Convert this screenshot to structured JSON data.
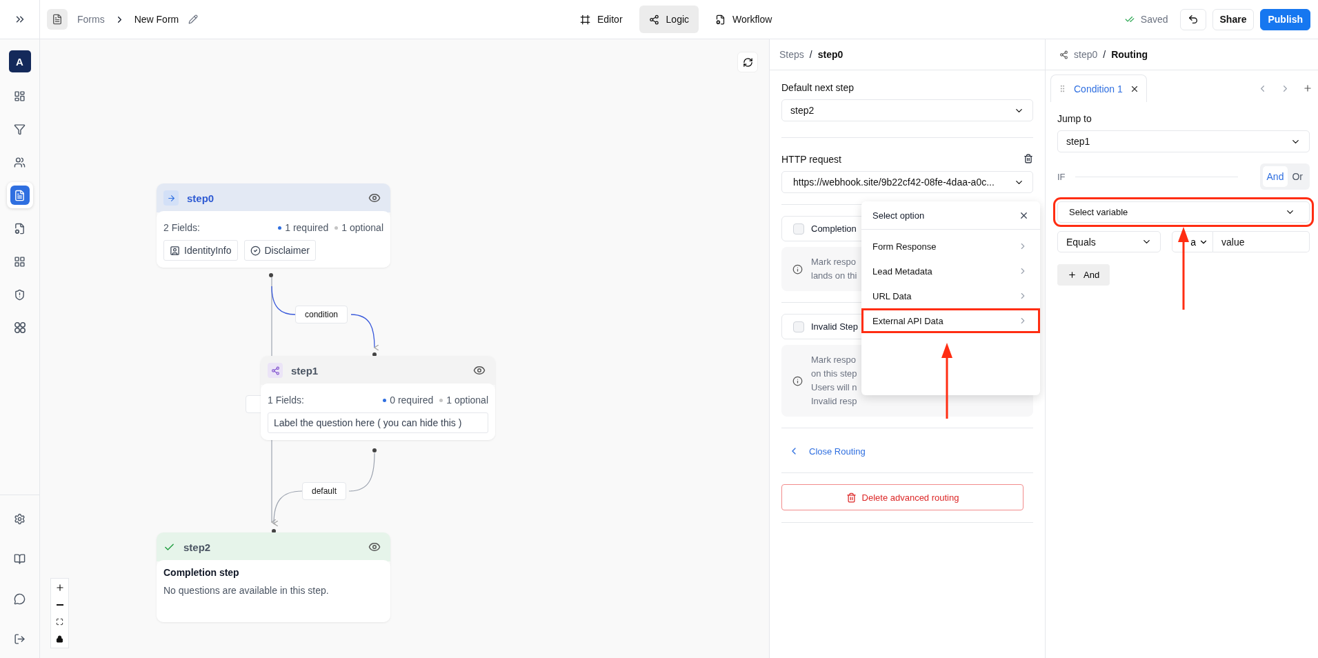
{
  "top_bar": {
    "breadcrumb": [
      {
        "label": "Forms"
      },
      {
        "label": "New Form"
      }
    ],
    "tabs": [
      {
        "label": "Editor",
        "selected": false
      },
      {
        "label": "Logic",
        "selected": true
      },
      {
        "label": "Workflow",
        "selected": false
      }
    ],
    "status": "Saved",
    "buttons": [
      {
        "label": "Share",
        "kind": "secondary"
      },
      {
        "label": "Publish",
        "kind": "primary"
      }
    ]
  },
  "sidebar": {
    "avatar": "A",
    "items": [
      {
        "selected": false
      },
      {
        "selected": false
      },
      {
        "selected": false
      },
      {
        "selected": true
      },
      {
        "selected": false
      },
      {
        "selected": false
      },
      {
        "selected": false
      },
      {
        "selected": false
      }
    ]
  },
  "canvas": {
    "nodes": [
      {
        "kind": "start",
        "title": "step0",
        "fields_label": "2 Fields:",
        "required": "1 required",
        "optional": "1 optional",
        "fields": [
          {
            "kind": "identity",
            "label": "IdentityInfo"
          },
          {
            "kind": "disclaimer",
            "label": "Disclaimer"
          }
        ]
      },
      {
        "kind": "branch",
        "title": "step1",
        "fields_label": "1 Fields:",
        "required": "0 required",
        "optional": "1 optional",
        "fields": [
          {
            "kind": "text",
            "label": "Label the question here ( you can hide this )"
          }
        ]
      },
      {
        "kind": "completion",
        "title": "step2",
        "heading": "Completion step",
        "description": "No questions are available in this step."
      }
    ],
    "edges": [
      {
        "kind": "condition",
        "label": "condition"
      },
      {
        "kind": "default",
        "label": "default"
      }
    ]
  },
  "step_panel": {
    "breadcrumb": [
      "Steps",
      "step0"
    ],
    "separator": "/",
    "default_next_step": {
      "label": "Default next step",
      "value": "step2"
    },
    "http_request": {
      "label": "HTTP request",
      "value": "https://webhook.site/9b22cf42-08fe-4daa-a0c..."
    },
    "options": [
      {
        "label": "Completion",
        "checked": false,
        "info": "Mark respo\nlands on thi"
      },
      {
        "label": "Invalid Step",
        "checked": false,
        "info": "Mark respo\non this step\nUsers will n\nInvalid resp"
      }
    ],
    "close_routing": "Close Routing",
    "delete_button": "Delete advanced routing"
  },
  "popover": {
    "title": "Select option",
    "items": [
      {
        "label": "Form Response",
        "highlighted": false
      },
      {
        "label": "Lead Metadata",
        "highlighted": false
      },
      {
        "label": "URL Data",
        "highlighted": false
      },
      {
        "label": "External API Data",
        "highlighted": true
      }
    ]
  },
  "routing_panel": {
    "breadcrumb": [
      "step0",
      "Routing"
    ],
    "separator": "/",
    "tabs": [
      {
        "label": "Condition 1",
        "selected": true
      }
    ],
    "jump_to": {
      "label": "Jump to",
      "value": "step1"
    },
    "if_label": "IF",
    "logic": [
      {
        "label": "And",
        "selected": true
      },
      {
        "label": "Or",
        "selected": false
      }
    ],
    "variable_select": {
      "placeholder": "Select variable",
      "highlighted": true
    },
    "operator": "Equals",
    "type_value": "a",
    "value": "value",
    "add_button": "And"
  }
}
